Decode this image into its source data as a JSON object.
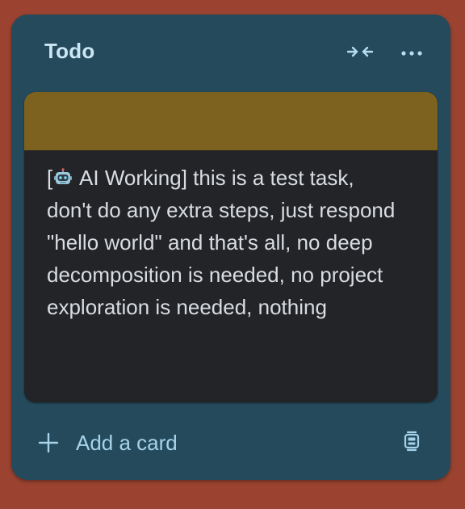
{
  "list": {
    "title": "Todo",
    "collapse_icon": "collapse-arrows-icon",
    "more_icon": "more-horizontal-icon"
  },
  "card": {
    "cover_color": "#7d611e",
    "text_prefix": "[",
    "robot_icon": "robot-icon",
    "text_body": " AI Working] this is a test task, don't do any extra steps, just respond \"hello world\" and that's all, no deep decomposition is needed, no project exploration is needed, nothing"
  },
  "footer": {
    "add_label": "Add a card",
    "plus_icon": "plus-icon",
    "template_icon": "card-template-icon"
  },
  "colors": {
    "board_background": "#9b4330",
    "list_background": "#244a5c",
    "card_background": "#232427",
    "title_text": "#cce6f4",
    "accent_text": "#a6d3ea"
  }
}
